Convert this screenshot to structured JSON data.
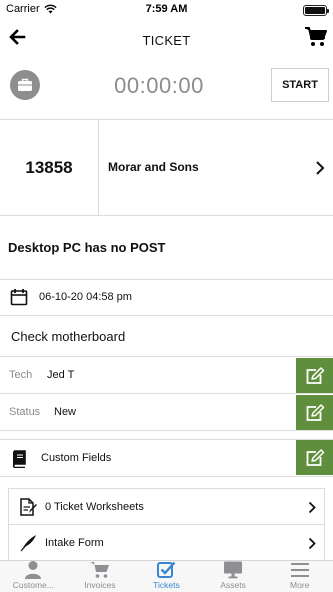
{
  "status_bar": {
    "carrier": "Carrier",
    "time": "7:59 AM",
    "battery_level": 1.0
  },
  "nav": {
    "title": "TICKET",
    "back_icon": "back-arrow-icon",
    "right_icon": "cart-icon"
  },
  "timer": {
    "icon": "briefcase-icon",
    "display": "00:00:00",
    "start_label": "START"
  },
  "ticket": {
    "number": "13858",
    "customer": "Morar and Sons"
  },
  "subject": "Desktop PC has no POST",
  "created": {
    "icon": "calendar-icon",
    "datetime": "06-10-20 04:58 pm"
  },
  "problem": "Check motherboard",
  "fields": [
    {
      "label": "Tech",
      "value": "Jed T"
    },
    {
      "label": "Status",
      "value": "New"
    }
  ],
  "custom_fields": {
    "label": "Custom Fields",
    "icon": "book-icon"
  },
  "links": [
    {
      "label": "0 Ticket Worksheets",
      "icon": "worksheet-icon"
    },
    {
      "label": "Intake Form",
      "icon": "quill-icon"
    }
  ],
  "tabs": [
    {
      "label": "Custome...",
      "icon": "person-icon",
      "active": false
    },
    {
      "label": "Invoices",
      "icon": "cart-icon",
      "active": false
    },
    {
      "label": "Tickets",
      "icon": "checkbox-icon",
      "active": true
    },
    {
      "label": "Assets",
      "icon": "monitor-icon",
      "active": false
    },
    {
      "label": "More",
      "icon": "menu-icon",
      "active": false
    }
  ],
  "colors": {
    "accent_green": "#5f8f3c",
    "active_tab": "#3a86d4",
    "inactive_tab": "#8e8e93",
    "timer_text": "#8c8c8c"
  }
}
